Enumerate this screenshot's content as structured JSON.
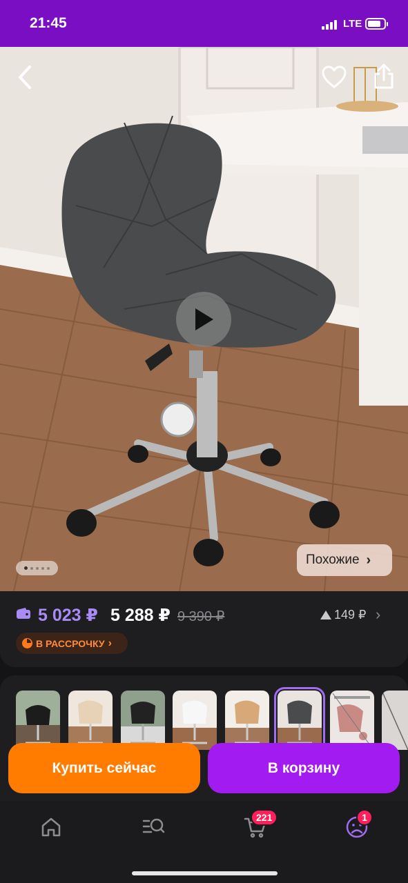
{
  "status_bar": {
    "time": "21:45",
    "network": "LTE",
    "signal_icon": "signal-bars-icon",
    "battery_icon": "battery-icon",
    "background": "#7a0ec2"
  },
  "hero": {
    "back_icon": "chevron-left-icon",
    "favorite_icon": "heart-icon",
    "share_icon": "share-icon",
    "play_icon": "play-icon",
    "gallery_pages": 5,
    "gallery_active_index": 0,
    "similar_label": "Похожие",
    "similar_chevron": "›"
  },
  "price": {
    "wallet_icon": "wallet-icon",
    "wallet_price": "5 023 ₽",
    "main_price": "5 288 ₽",
    "old_price": "9 390 ₽",
    "delta_icon": "triangle-up-icon",
    "delta": "149 ₽",
    "more_chevron": "›",
    "installment_label": "В РАССРОЧКУ",
    "installment_chevron": "›",
    "accent_color": "#a98bf5"
  },
  "variants": {
    "items": [
      {
        "name": "black-chrome",
        "selected": false
      },
      {
        "name": "beige",
        "selected": false
      },
      {
        "name": "black-mesh",
        "selected": false
      },
      {
        "name": "white",
        "selected": false
      },
      {
        "name": "tan",
        "selected": false
      },
      {
        "name": "dark-gray",
        "selected": true
      },
      {
        "name": "pink-scheme",
        "selected": false
      },
      {
        "name": "white-scheme",
        "selected": false
      }
    ]
  },
  "actions": {
    "buy_now": "Купить сейчас",
    "add_to_cart": "В корзину",
    "buy_color": "#ff7c00",
    "cart_color": "#a21cf2"
  },
  "tab_bar": {
    "tabs": [
      {
        "name": "home",
        "icon": "home-icon"
      },
      {
        "name": "catalog",
        "icon": "search-list-icon"
      },
      {
        "name": "cart",
        "icon": "cart-icon",
        "badge": "221"
      },
      {
        "name": "profile",
        "icon": "profile-icon",
        "badge": "1"
      }
    ]
  }
}
